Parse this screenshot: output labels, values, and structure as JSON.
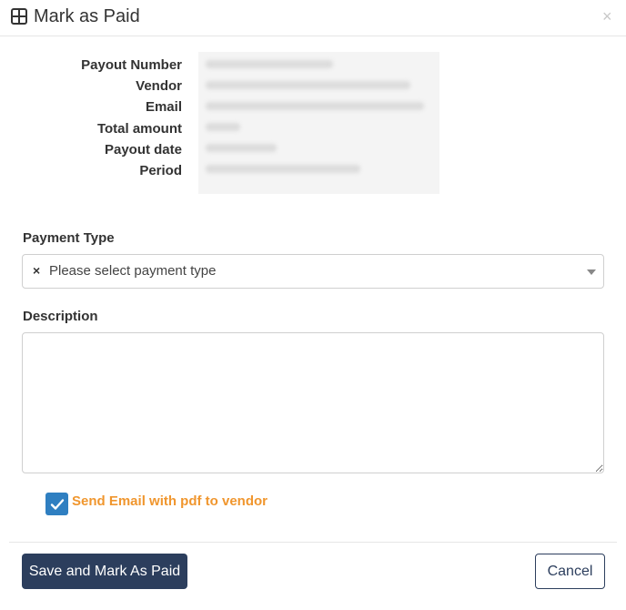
{
  "dialog": {
    "title": "Mark as Paid",
    "title_icon": "table-grid-icon",
    "close_label": "×"
  },
  "payout_info": {
    "labels": [
      "Payout Number",
      "Vendor",
      "Email",
      "Total amount",
      "Payout date",
      "Period"
    ]
  },
  "payment_type": {
    "label": "Payment Type",
    "clear_label": "×",
    "placeholder": "Please select payment type"
  },
  "description": {
    "label": "Description",
    "value": ""
  },
  "send_email": {
    "checked": true,
    "label": "Send Email with pdf to vendor"
  },
  "buttons": {
    "save": "Save and Mark As Paid",
    "cancel": "Cancel"
  },
  "colors": {
    "primary": "#2c3e5d",
    "checkbox": "#2f7fc1",
    "accent_text": "#f0962e"
  }
}
